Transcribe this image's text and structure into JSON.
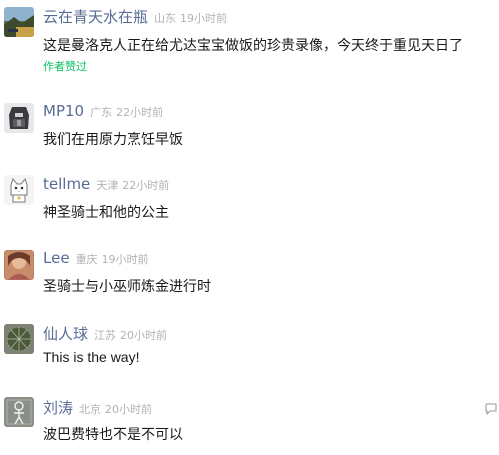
{
  "comments": [
    {
      "user": "云在青天水在瓶",
      "location": "山东",
      "time": "19小时前",
      "text": "这是曼洛克人正在给尤达宝宝做饭的珍贵录像，今天终于重见天日了",
      "liked_label": "作者赞过",
      "avatar_icon": "landscape-avatar-icon"
    },
    {
      "user": "MP10",
      "location": "广东",
      "time": "22小时前",
      "text": "我们在用原力烹饪早饭",
      "avatar_icon": "robot-avatar-icon"
    },
    {
      "user": "tellme",
      "location": "天津",
      "time": "22小时前",
      "text": "神圣骑士和他的公主",
      "avatar_icon": "cat-avatar-icon"
    },
    {
      "user": "Lee",
      "location": "重庆",
      "time": "19小时前",
      "text": "圣骑士与小巫师炼金进行时",
      "avatar_icon": "photo-avatar-icon"
    },
    {
      "user": "仙人球",
      "location": "江苏",
      "time": "20小时前",
      "text": "This is the way!",
      "avatar_icon": "cactus-avatar-icon"
    },
    {
      "user": "刘涛",
      "location": "北京",
      "time": "20小时前",
      "text": "波巴费特也不是不可以",
      "avatar_icon": "figure-avatar-icon",
      "action_icon": "reply-icon"
    }
  ],
  "colors": {
    "username": "#576b95",
    "meta": "#b2b2b2",
    "text": "#191919",
    "liked": "#07c160"
  }
}
